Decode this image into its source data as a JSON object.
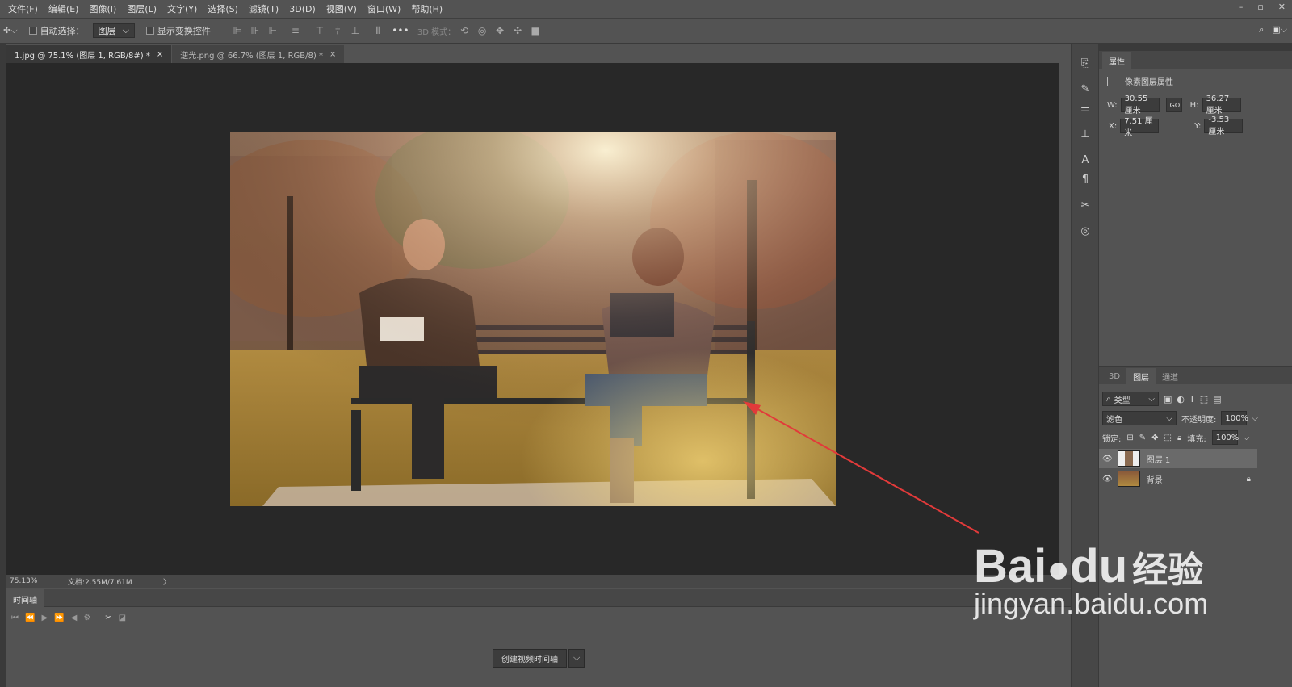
{
  "menu": [
    "文件(F)",
    "编辑(E)",
    "图像(I)",
    "图层(L)",
    "文字(Y)",
    "选择(S)",
    "滤镜(T)",
    "3D(D)",
    "视图(V)",
    "窗口(W)",
    "帮助(H)"
  ],
  "window_controls": [
    "–",
    "▫",
    "✕"
  ],
  "options": {
    "auto_select_label": "自动选择：",
    "auto_select_value": "图层",
    "show_transform_label": "显示变换控件",
    "mode_3d_label": "3D 模式："
  },
  "tabs": [
    {
      "label": "1.jpg @ 75.1% (图层 1, RGB/8#) *",
      "close": "×"
    },
    {
      "label": "逆光.png @ 66.7% (图层 1, RGB/8) *",
      "close": "×"
    }
  ],
  "status": {
    "zoom": "75.13%",
    "doc": "文档:2.55M/7.61M",
    "arrow": "〉"
  },
  "timeline": {
    "title": "时间轴",
    "create_button": "创建视频时间轴",
    "dropdown": "⌵"
  },
  "properties": {
    "tab": "属性",
    "subtitle": "像素图层属性",
    "w_label": "W:",
    "w_value": "30.55 厘米",
    "h_label": "H:",
    "h_value": "36.27 厘米",
    "x_label": "X:",
    "x_value": "7.51 厘米",
    "y_label": "Y:",
    "y_value": "-3.53 厘米",
    "link": "GO"
  },
  "layers_panel": {
    "tabs": [
      "3D",
      "图层",
      "通道"
    ],
    "filter_label": "类型",
    "blend_mode": "滤色",
    "opacity_label": "不透明度:",
    "opacity_value": "100%",
    "lock_label": "锁定:",
    "fill_label": "填充:",
    "fill_value": "100%",
    "layers": [
      {
        "name": "图层 1",
        "visible": true,
        "locked": false
      },
      {
        "name": "背景",
        "visible": true,
        "locked": true
      }
    ]
  },
  "watermark": {
    "brand": "Bai",
    "brand2": "du",
    "cn": "经验",
    "url": "jingyan.baidu.com"
  },
  "colors": {
    "annotation": "#e23a3a",
    "canvas_bg": "#282828",
    "panel_bg": "#535353"
  }
}
